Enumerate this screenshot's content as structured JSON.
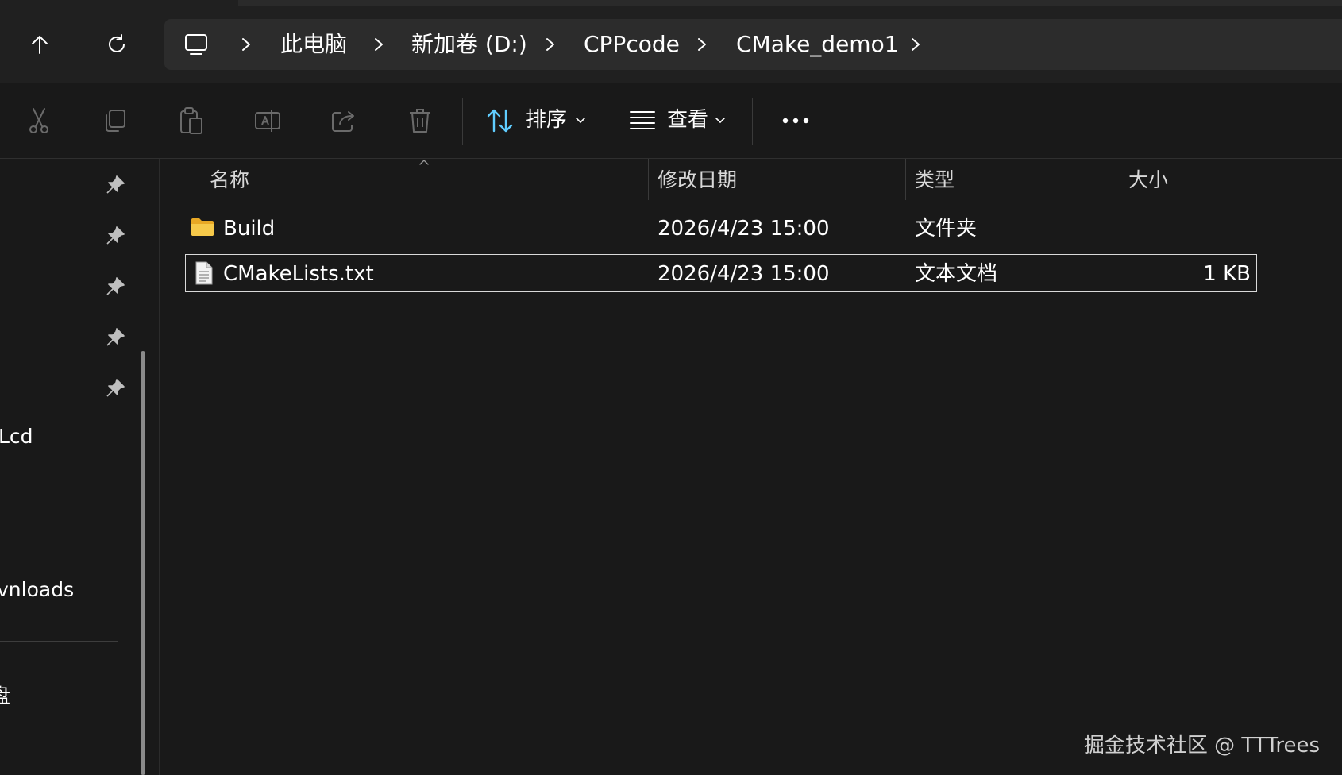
{
  "address": {
    "crumbs": [
      "此电脑",
      "新加卷 (D:)",
      "CPPcode",
      "CMake_demo1"
    ]
  },
  "toolbar": {
    "sort_label": "排序",
    "view_label": "查看"
  },
  "sidebar": {
    "visible_labels": [
      "Lcd",
      "vnloads",
      "盘"
    ]
  },
  "columns": {
    "name": "名称",
    "modified": "修改日期",
    "type": "类型",
    "size": "大小"
  },
  "files": [
    {
      "name": "Build",
      "modified": "2026/4/23 15:00",
      "type": "文件夹",
      "size": "",
      "icon": "folder-icon"
    },
    {
      "name": "CMakeLists.txt",
      "modified": "2026/4/23 15:00",
      "type": "文本文档",
      "size": "1 KB",
      "icon": "text-file-icon"
    }
  ],
  "watermark": "掘金技术社区 @ TTTrees",
  "colors": {
    "background": "#191919",
    "folder": "#f4c542",
    "accent": "#60cdff"
  }
}
